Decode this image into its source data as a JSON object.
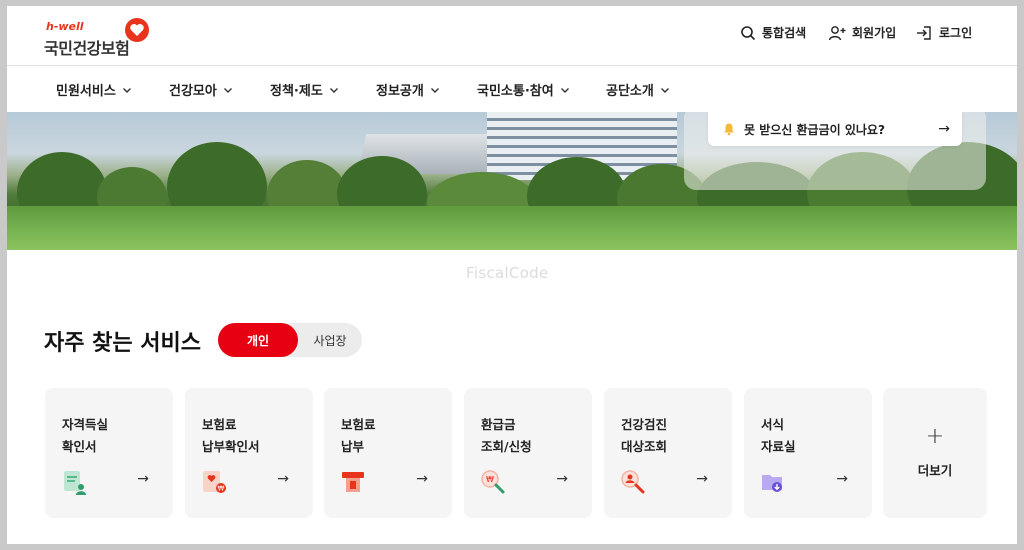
{
  "logo": {
    "small": "h-well",
    "main": "국민건강보험"
  },
  "utility": {
    "search": "통합검색",
    "signup": "회원가입",
    "login": "로그인"
  },
  "nav": [
    {
      "label": "민원서비스"
    },
    {
      "label": "건강모아"
    },
    {
      "label": "정책·제도"
    },
    {
      "label": "정보공개"
    },
    {
      "label": "국민소통·참여"
    },
    {
      "label": "공단소개"
    }
  ],
  "hero": {
    "refund_text": "못 받으신 환급금이 있나요?",
    "refund_arrow": "→"
  },
  "watermark": "FiscalCode",
  "services": {
    "title": "자주 찾는 서비스",
    "toggle_personal": "개인",
    "toggle_business": "사업장",
    "cards": [
      {
        "line1": "자격득실",
        "line2": "확인서",
        "icon": "certificate-icon"
      },
      {
        "line1": "보험료",
        "line2": "납부확인서",
        "icon": "payment-certificate-icon"
      },
      {
        "line1": "보험료",
        "line2": "납부",
        "icon": "payment-icon"
      },
      {
        "line1": "환급금",
        "line2": "조회/신청",
        "icon": "refund-search-icon"
      },
      {
        "line1": "건강검진",
        "line2": "대상조회",
        "icon": "checkup-search-icon"
      },
      {
        "line1": "서식",
        "line2": "자료실",
        "icon": "folder-download-icon"
      }
    ],
    "arrow": "→",
    "more_plus": "+",
    "more_label": "더보기"
  },
  "colors": {
    "brand_red": "#e60012",
    "card_bg": "#f5f5f5"
  }
}
